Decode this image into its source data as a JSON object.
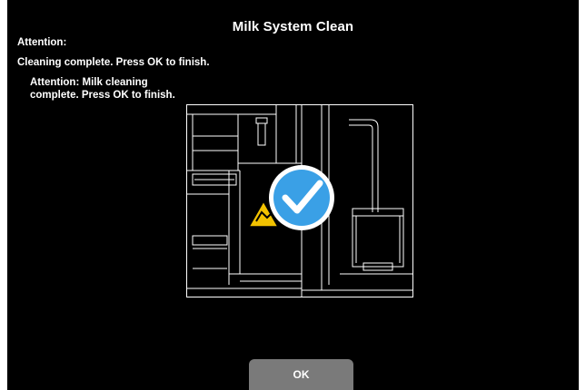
{
  "screen": {
    "title": "Milk System Clean",
    "attention_heading": "Attention:",
    "attention_text": "Cleaning complete. Press OK to finish.",
    "attention_note": "Attention: Milk cleaning complete. Press OK to finish.",
    "ok_label": "OK"
  },
  "illustration": {
    "subject": "coffee-machine-outline",
    "status_icon": "checkmark-icon",
    "warning_icon": "hand-pinch-warning-icon",
    "colors": {
      "background": "#000000",
      "outline": "#ffffff",
      "check_fill": "#3aa0e6",
      "check_border": "#ffffff",
      "warning_fill": "#f2c200"
    }
  },
  "colors": {
    "screen_background": "#000000",
    "text": "#ffffff",
    "button_background": "#7a7a7a"
  }
}
